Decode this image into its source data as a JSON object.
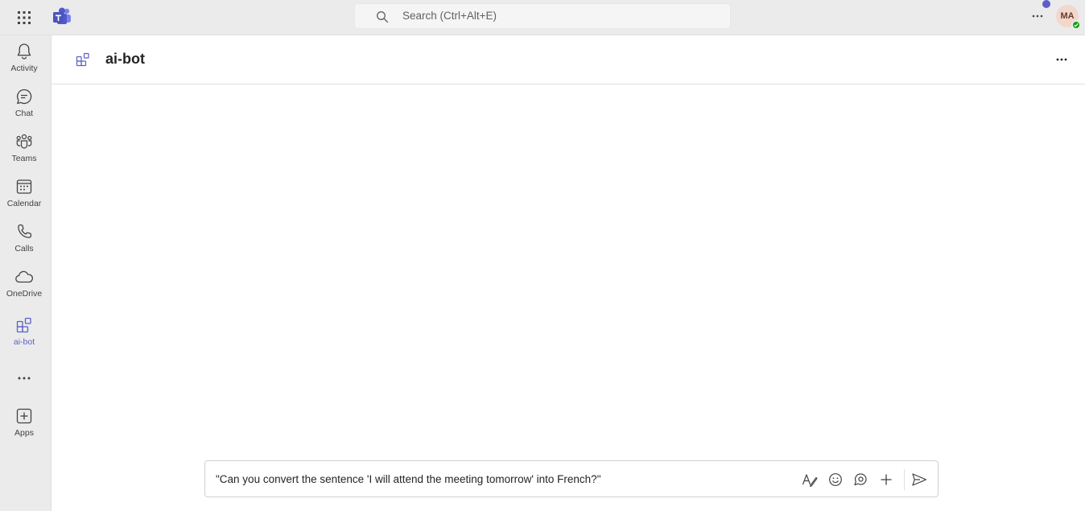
{
  "topbar": {
    "search_placeholder": "Search (Ctrl+Alt+E)",
    "avatar_initials": "MA",
    "icons": [
      "app-launcher-icon",
      "teams-logo-icon",
      "search-icon",
      "more-options-icon"
    ]
  },
  "rail": {
    "items": [
      {
        "label": "Activity",
        "icon": "bell-icon"
      },
      {
        "label": "Chat",
        "icon": "chat-icon"
      },
      {
        "label": "Teams",
        "icon": "teams-icon"
      },
      {
        "label": "Calendar",
        "icon": "calendar-icon"
      },
      {
        "label": "Calls",
        "icon": "phone-icon"
      },
      {
        "label": "OneDrive",
        "icon": "cloud-icon"
      },
      {
        "label": "ai-bot",
        "icon": "app-icon",
        "active": true
      },
      {
        "label": "Apps",
        "icon": "add-app-icon"
      }
    ]
  },
  "main": {
    "title": "ai-bot"
  },
  "composer": {
    "message": "\"Can you convert the sentence 'I will attend the meeting tomorrow' into French?\"",
    "tools": [
      "format-icon",
      "emoji-icon",
      "loop-icon",
      "plus-icon",
      "send-icon"
    ]
  },
  "colors": {
    "accent": "#5b5fc7",
    "background": "#ebebeb",
    "presence": "#13a10e"
  }
}
